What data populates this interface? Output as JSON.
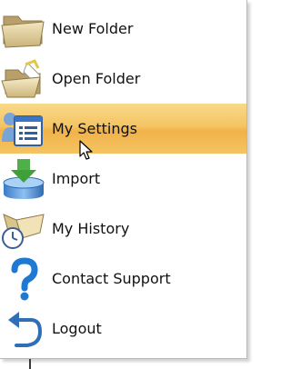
{
  "menu": {
    "items": [
      {
        "label": "New Folder",
        "icon": "folder-icon"
      },
      {
        "label": "Open Folder",
        "icon": "open-folder-icon"
      },
      {
        "label": "My Settings",
        "icon": "settings-icon",
        "highlighted": true
      },
      {
        "label": "Import",
        "icon": "import-icon"
      },
      {
        "label": "My History",
        "icon": "history-icon"
      },
      {
        "label": "Contact Support",
        "icon": "help-icon"
      },
      {
        "label": "Logout",
        "icon": "logout-icon"
      }
    ]
  },
  "colors": {
    "highlight": "#f4c462",
    "help_blue": "#1f78d1",
    "text": "#111111"
  }
}
